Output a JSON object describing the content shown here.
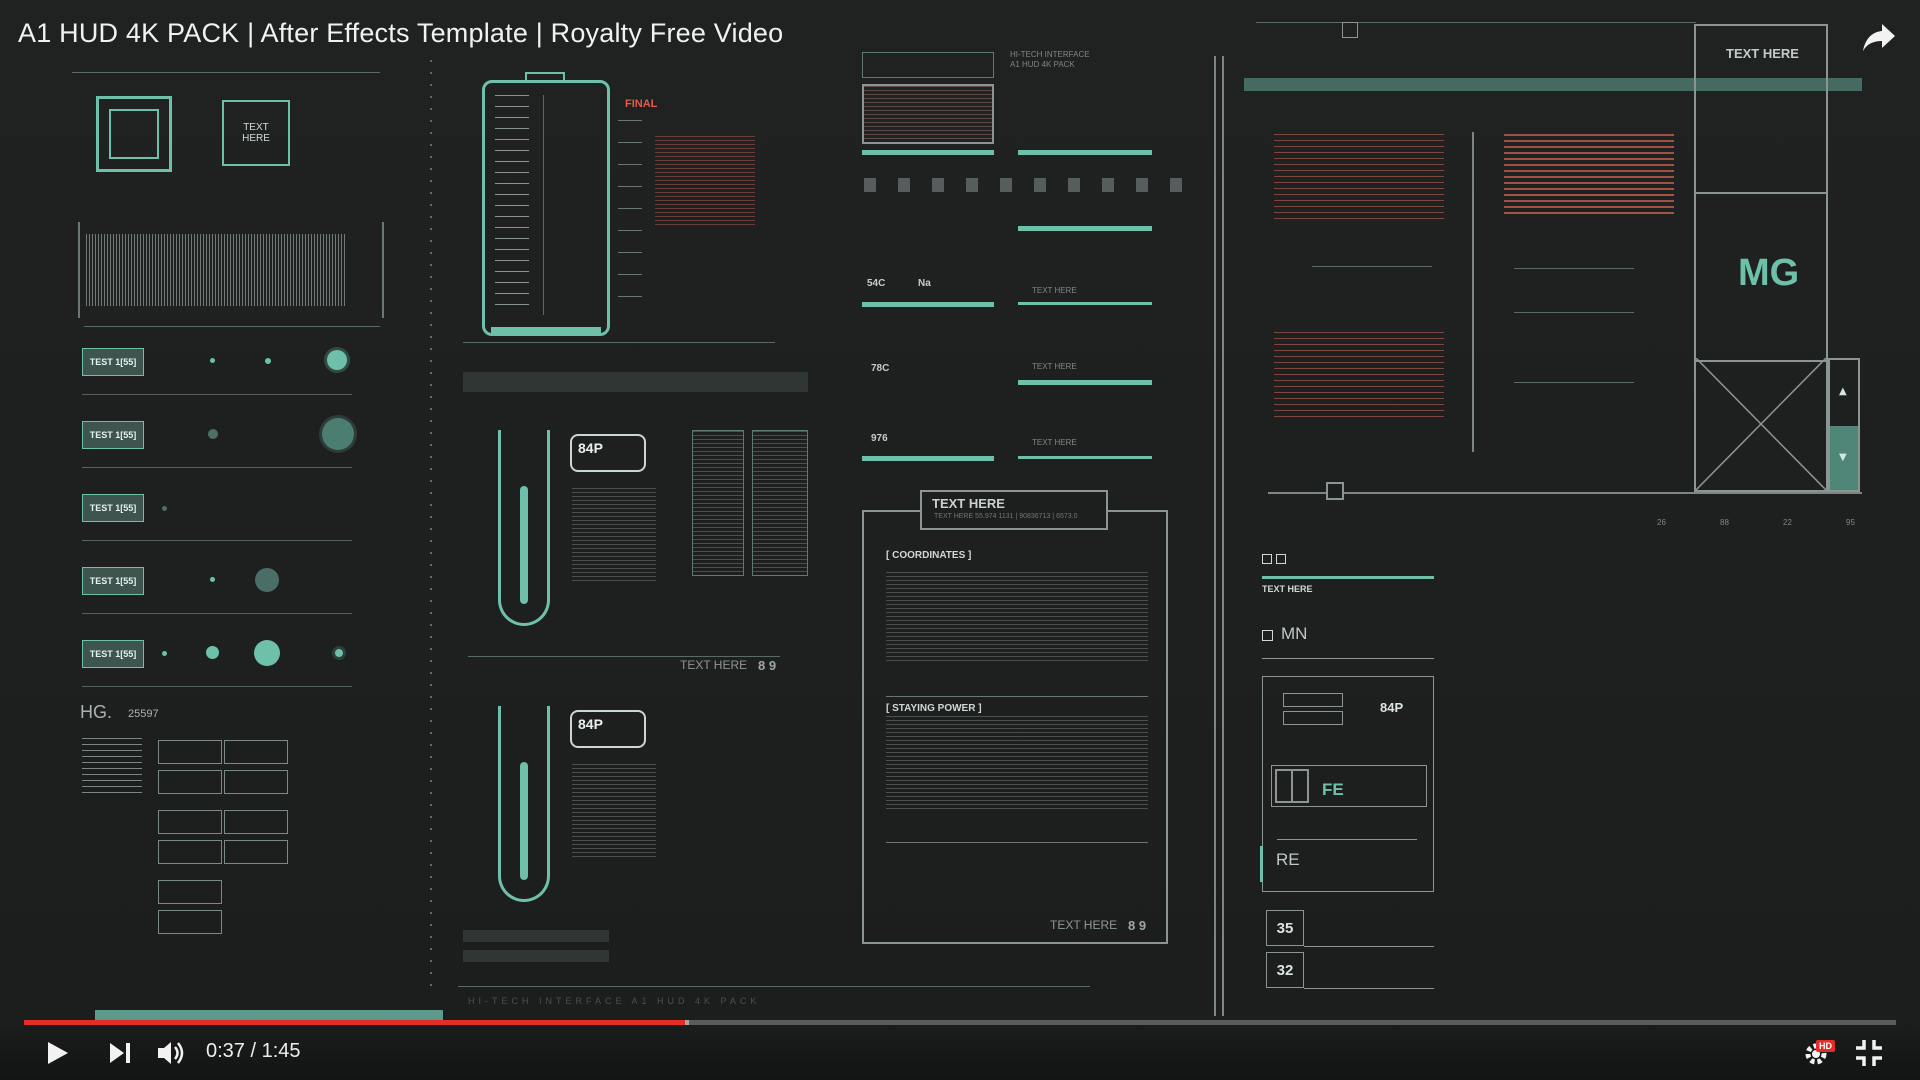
{
  "video": {
    "title": "A1 HUD 4K PACK | After Effects Template | Royalty Free Video",
    "current_time": "0:37",
    "separator": " / ",
    "duration": "1:45",
    "progress_fraction": 0.353,
    "buffered_fraction": 0.355,
    "hd_badge": "HD",
    "accent_color": "#e52d27"
  },
  "controls": {
    "play_icon": "play-icon",
    "next_icon": "next-icon",
    "volume_icon": "volume-icon",
    "settings_icon": "settings-icon",
    "exit_fullscreen_icon": "exit-fullscreen-icon",
    "share_icon": "share-icon"
  },
  "hud": {
    "theme_color": "#6fc0ab",
    "text_here_box": "TEXT\nHERE",
    "test_buttons": [
      "TEST 1[55]",
      "TEST 1[55]",
      "TEST 1[55]",
      "TEST 1[55]",
      "TEST 1[55]"
    ],
    "hg_label": "HG.",
    "hg_value": "25597",
    "final_label": "FINAL",
    "text_here_small": "TEXT HERE",
    "hitech_line1": "HI-TECH INTERFACE",
    "hitech_line2": "A1 HUD 4K PACK",
    "val_54c": "54C",
    "val_na": "Na",
    "val_78c": "78C",
    "val_976": "976",
    "bubble_84p": "84P",
    "text_here_89": "TEXT HERE",
    "num_89": "8 9",
    "panel_title": "TEXT HERE",
    "panel_sub": "TEXT HERE 55.974 1131 | 90836713 | 6573.0",
    "coordinates": "[ COORDINATES ]",
    "staying_power": "[ STAYING POWER ]",
    "bottom_strip": "HI-TECH INTERFACE A1 HUD 4K PACK",
    "right_title": "TEXT HERE",
    "mg": "MG",
    "mn": "MN",
    "fe": "FE",
    "re": "RE",
    "text_here_bold": "TEXT HERE",
    "n35": "35",
    "n32": "32",
    "scale_26": "26",
    "scale_88": "88",
    "scale_22": "22",
    "scale_95": "95",
    "up_arrow": "▲",
    "down_arrow": "▼"
  }
}
